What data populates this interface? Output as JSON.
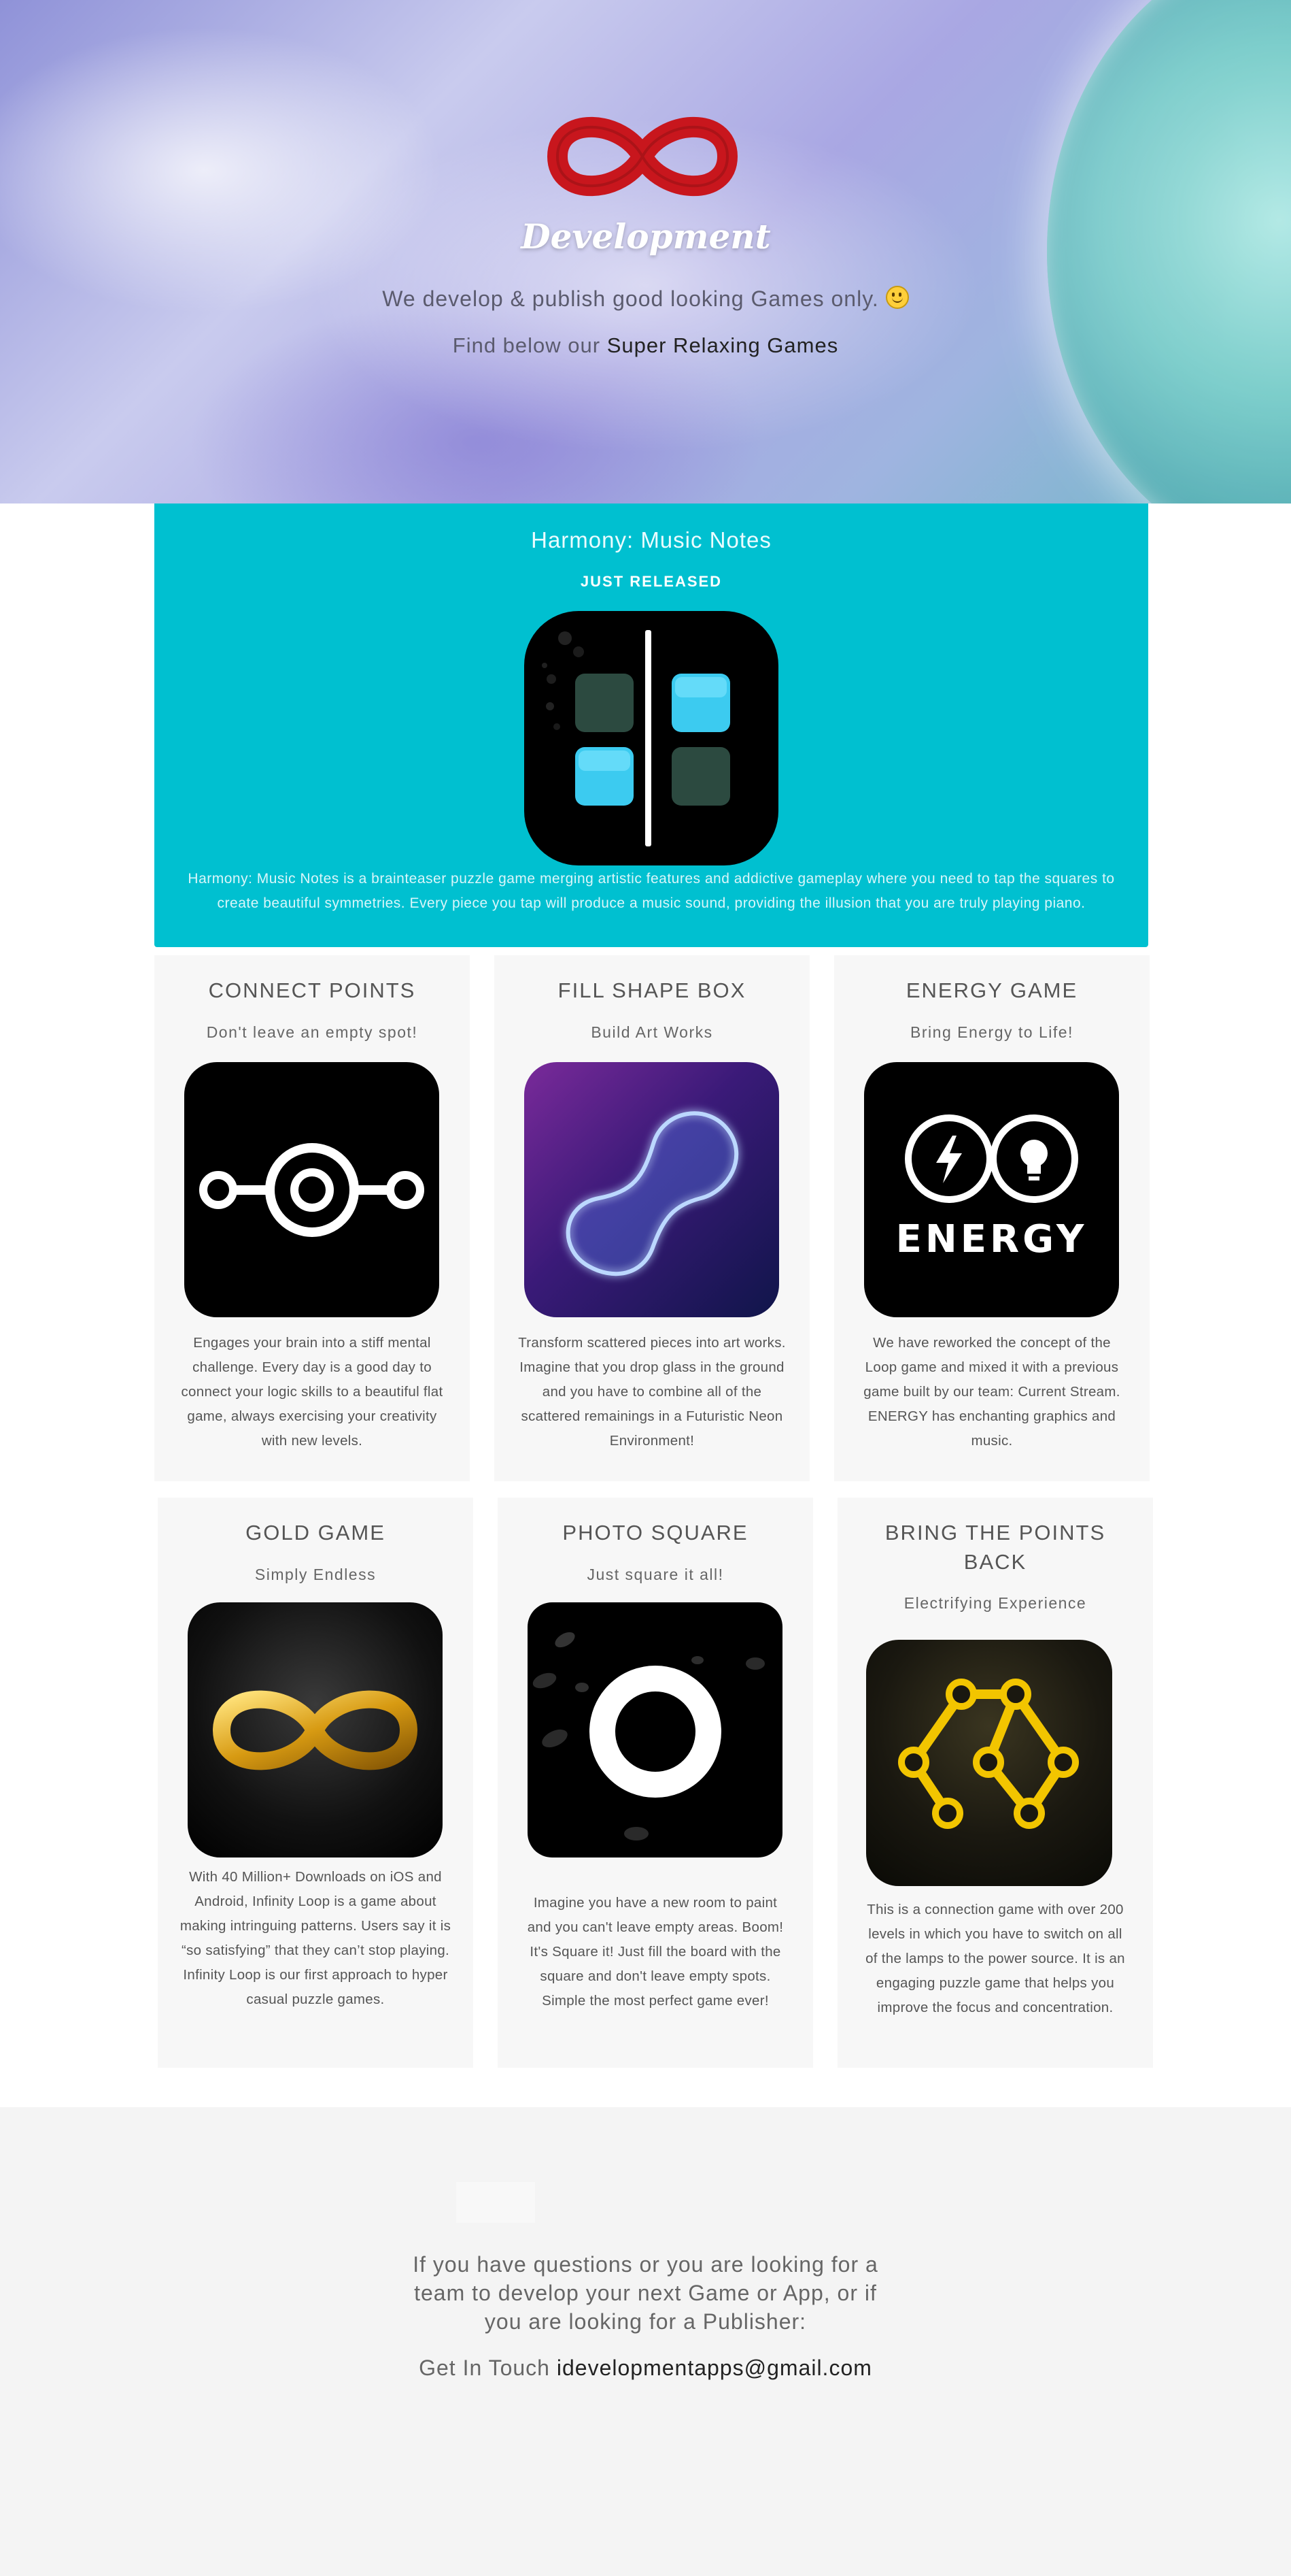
{
  "hero": {
    "logo_word": "Development",
    "line1": "We develop & publish good looking Games only.",
    "line2_prefix": "Find below our ",
    "line2_strong": "Super Relaxing Games"
  },
  "featured": {
    "title": "Harmony: Music Notes",
    "badge": "JUST RELEASED",
    "desc": "Harmony: Music Notes is a brainteaser puzzle game merging artistic features and addictive gameplay where you need to tap the squares to create beautiful symmetries. Every piece you tap will produce a music sound, providing the illusion that you are truly playing piano."
  },
  "games": [
    {
      "title": "CONNECT POINTS",
      "subtitle": "Don't leave an empty spot!",
      "icon": "connect-points-icon",
      "desc": "Engages your brain into a stiff mental challenge. Every day is a good day to connect your logic skills to a beautiful flat game, always exercising your creativity with new levels."
    },
    {
      "title": "FILL SHAPE BOX",
      "subtitle": "Build Art Works",
      "icon": "neon-shape-icon",
      "desc": "Transform scattered pieces into art works. Imagine that you drop glass in the ground and you have to combine all of the scattered remainings in a Futuristic Neon Environment!"
    },
    {
      "title": "ENERGY GAME",
      "subtitle": "Bring Energy to Life!",
      "icon": "energy-icon",
      "icon_text": "ENERGY",
      "desc": "We have reworked the concept of the Loop game and mixed it with a previous game built by our team: Current Stream. ENERGY has enchanting graphics and music."
    },
    {
      "title": "GOLD GAME",
      "subtitle": "Simply Endless",
      "icon": "gold-infinity-icon",
      "desc": "With 40 Million+ Downloads on iOS and Android, Infinity Loop is a game about making intringuing patterns. Users say it is “so satisfying” that they can’t stop playing. Infinity Loop is our first approach to hyper casual puzzle games."
    },
    {
      "title": "PHOTO SQUARE",
      "subtitle": "Just square it all!",
      "icon": "photo-square-icon",
      "desc": "Imagine you have a new room to paint and you can't leave empty areas. Boom! It's Square it! Just fill the board with the square and don't leave empty spots. Simple the most perfect game ever!"
    },
    {
      "title": "BRING THE POINTS BACK",
      "subtitle": "Electrifying Experience",
      "icon": "bring-points-icon",
      "desc": "This is a connection game with over 200 levels in which you have to switch on all of the lamps to the power source. It is an engaging puzzle game that helps you improve the focus and concentration."
    }
  ],
  "footer": {
    "question": "If you have questions or you are looking for a team to develop your next Game or App, or if you are looking for a Publisher:",
    "contact_prefix": "Get In Touch ",
    "email": "idevelopmentapps@gmail.com"
  },
  "colors": {
    "featured_bg": "#00c0d0",
    "card_bg": "#f7f7f7",
    "footer_bg": "#f4f4f4",
    "logo_red": "#c8161d"
  }
}
